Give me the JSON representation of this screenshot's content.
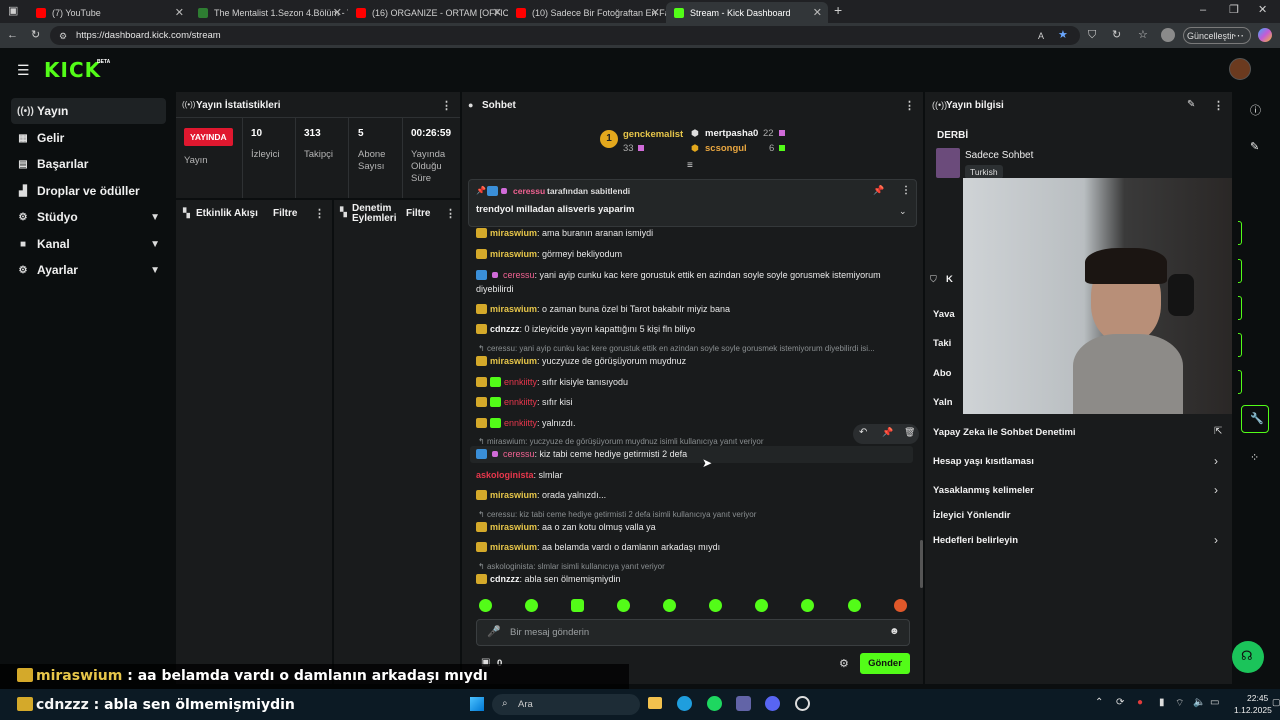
{
  "browser": {
    "tabs": [
      {
        "title": "(7) YouTube",
        "color": "#ff0000"
      },
      {
        "title": "The Mentalist 1.Sezon 4.Bölüm - Y",
        "color": "#2e7d32"
      },
      {
        "title": "(16) ORGANIZE - ORTAM [OFFICIA",
        "color": "#ff0000"
      },
      {
        "title": "(10) Sadece Bir Fotoğraftan En Fa",
        "color": "#ff0000"
      },
      {
        "title": "Stream - Kick Dashboard",
        "color": "#53fc18"
      }
    ],
    "url": "https://dashboard.kick.com/stream",
    "update_label": "Güncelleştir"
  },
  "app": {
    "logo": "KICK",
    "beta": "BETA",
    "accent": "#53fc18"
  },
  "nav": [
    {
      "label": "Yayın",
      "icon": "broadcast-icon",
      "active": true
    },
    {
      "label": "Gelir",
      "icon": "revenue-icon"
    },
    {
      "label": "Başarılar",
      "icon": "achievements-icon"
    },
    {
      "label": "Droplar ve ödüller",
      "icon": "gift-icon"
    },
    {
      "label": "Stüdyo",
      "icon": "studio-icon",
      "chevron": true
    },
    {
      "label": "Kanal",
      "icon": "channel-icon",
      "chevron": true
    },
    {
      "label": "Ayarlar",
      "icon": "settings-icon",
      "chevron": true
    }
  ],
  "stats": {
    "title": "Yayın İstatistikleri",
    "live_badge": "YAYINDA",
    "live_label": "Yayın",
    "viewers": "10",
    "viewers_label": "İzleyici",
    "followers": "313",
    "followers_label": "Takipçi",
    "subs": "5",
    "subs_label": "Abone Sayısı",
    "uptime": "00:26:59",
    "uptime_label": "Yayında Olduğu Süre"
  },
  "activity": {
    "title": "Etkinlik Akışı",
    "filter": "Filtre"
  },
  "moderation": {
    "title": "Denetim Eylemleri",
    "filter": "Filtre"
  },
  "chat": {
    "title": "Sohbet",
    "top_gifters": [
      {
        "rank": "1",
        "name": "genckemalist",
        "count": "33"
      },
      {
        "name": "mertpasha0",
        "count": "22"
      },
      {
        "name": "scsongul",
        "count": "6"
      }
    ],
    "pinned": {
      "by_user": "ceressu",
      "by_suffix": "tarafından sabitlendi",
      "text": "trendyol milladan alisveris yaparim"
    },
    "messages": [
      {
        "user": "miraswium",
        "text": ": ama buranın aranan ismiydi"
      },
      {
        "user": "miraswium",
        "text": ": görmeyi bekliyodum"
      },
      {
        "user": "ceressu",
        "text": ": yani ayip cunku kac kere gorustuk ettik en azindan soyle soyle gorusmek istemiyorum",
        "text2": "diyebilirdi"
      },
      {
        "user": "miraswium",
        "text": ": o zaman buna özel bi Tarot bakabılr miyiz bana"
      },
      {
        "user": "cdnzzz",
        "text": ": 0 izleyicide yayın kapattığını 5 kişi fln biliyo"
      },
      {
        "reply": "ceressu: yani ayip cunku kac kere gorustuk ettik en azindan soyle soyle gorusmek istemiyorum diyebilirdi isi..."
      },
      {
        "user": "miraswium",
        "text": ": yuczyuze de görüşüyorum muydnuz"
      },
      {
        "user": "ennkiitty",
        "text": ": sıfır kisiyle tanısıyodu"
      },
      {
        "user": "ennkiitty",
        "text": ": sıfır kisi"
      },
      {
        "user": "ennkiitty",
        "text": ": yalnızdı."
      },
      {
        "reply": "miraswium: yuczyuze de görüşüyorum muydnuz isimli kullanıcıya yanıt veriyor"
      },
      {
        "user": "ceressu",
        "text": ": kiz tabi ceme hediye getirmisti 2 defa"
      },
      {
        "user": "askologinista",
        "text": ": slmlar"
      },
      {
        "user": "miraswium",
        "text": ": orada yalnızdı..."
      },
      {
        "reply": "ceressu: kiz tabi ceme hediye getirmisti 2 defa isimli kullanıcıya yanıt veriyor"
      },
      {
        "user": "miraswium",
        "text": ": aa o zan kotu olmuş valla ya"
      },
      {
        "user": "miraswium",
        "text": ": aa belamda vardı o damlanın arkadaşı mıydı"
      },
      {
        "reply": "askologinista: slmlar isimli kullanıcıya yanıt veriyor"
      },
      {
        "user": "cdnzzz",
        "text": ": abla sen ölmemişmiydin"
      }
    ],
    "input_placeholder": "Bir mesaj gönderin",
    "points": "0",
    "send_label": "Gönder"
  },
  "info": {
    "title": "Yayın bilgisi",
    "stream_title": "DERBİ",
    "category": "Sadece Sohbet",
    "language": "Turkish",
    "peek_labels": [
      "Yava",
      "Taki",
      "Abo",
      "Yaln"
    ],
    "mod_items": [
      {
        "label": "Yapay Zeka ile Sohbet Denetimi",
        "icon": "external-link-icon"
      },
      {
        "label": "Hesap yaşı kısıtlaması",
        "icon": "chevron-right-icon"
      },
      {
        "label": "Yasaklanmış kelimeler",
        "icon": "chevron-right-icon"
      },
      {
        "label": "İzleyici Yönlendir"
      },
      {
        "label": "Hedefleri belirleyin",
        "icon": "chevron-right-icon"
      }
    ]
  },
  "overlay": {
    "line1_user": "miraswium",
    "line1_text": " : aa belamda vardı o damlanın arkadaşı mıydı",
    "line2_user": "cdnzzz",
    "line2_text": " : abla sen ölmemişmiydin"
  },
  "taskbar": {
    "search": "Ara",
    "time": "22:45",
    "date": "1.12.2025"
  }
}
